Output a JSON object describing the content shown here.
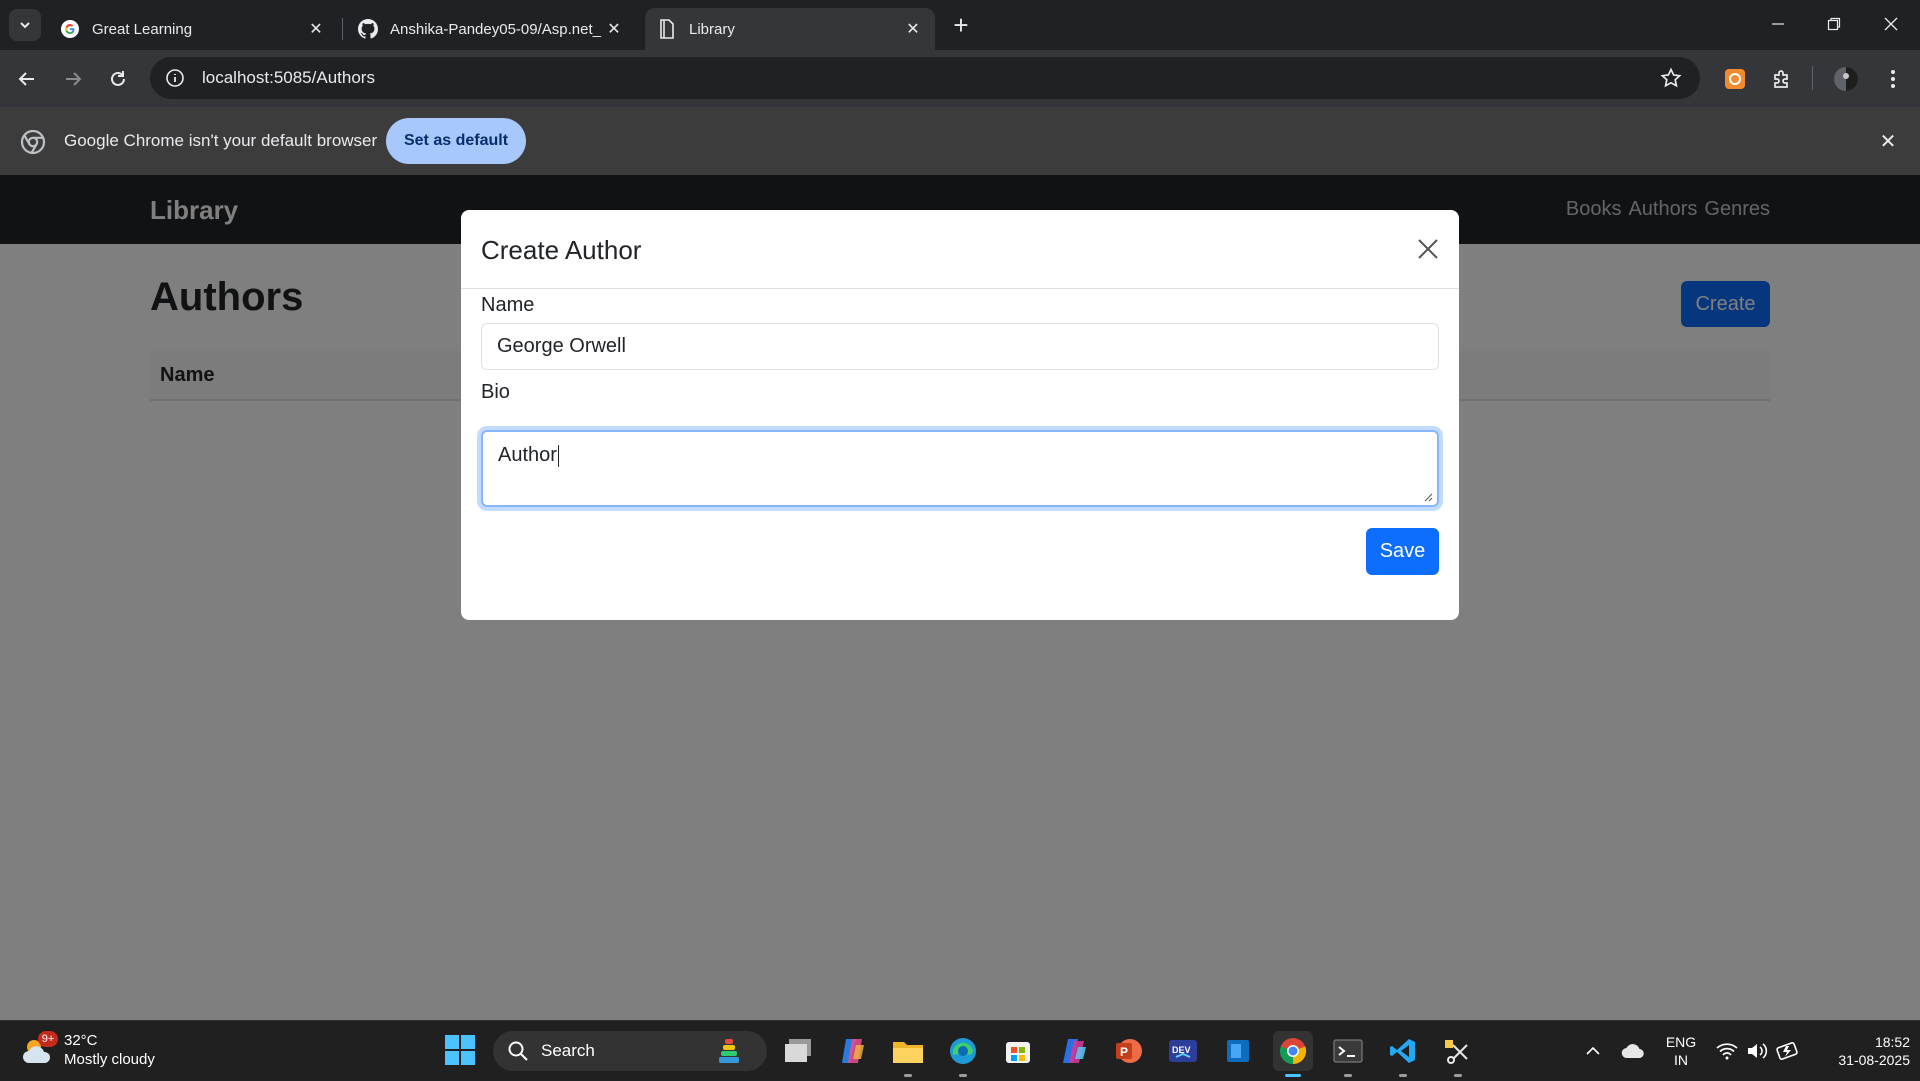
{
  "browser": {
    "tabs": [
      {
        "title": "Great Learning",
        "icon": "google-icon",
        "active": false
      },
      {
        "title": "Anshika-Pandey05-09/Asp.net_",
        "icon": "github-icon",
        "active": false
      },
      {
        "title": "Library",
        "icon": "document-icon",
        "active": true
      }
    ],
    "new_tab_label": "+",
    "url": "localhost:5085/Authors",
    "infobar": {
      "message": "Google Chrome isn't your default browser",
      "button_label": "Set as default"
    }
  },
  "app": {
    "brand": "Library",
    "nav_links": [
      "Books",
      "Authors",
      "Genres"
    ],
    "page_title": "Authors",
    "create_button": "Create",
    "table": {
      "headers": [
        "Name"
      ],
      "rows": []
    }
  },
  "modal": {
    "title": "Create Author",
    "fields": {
      "name": {
        "label": "Name",
        "value": "George Orwell"
      },
      "bio": {
        "label": "Bio",
        "value": "Author"
      }
    },
    "save_label": "Save"
  },
  "taskbar": {
    "weather": {
      "badge": "9+",
      "temp": "32°C",
      "condition": "Mostly cloudy"
    },
    "search_label": "Search",
    "apps": [
      "file-manager-icon",
      "copilot-icon",
      "file-explorer-icon",
      "edge-icon",
      "store-icon",
      "m365-icon",
      "powerpoint-icon",
      "devhome-icon",
      "blue-app-icon",
      "chrome-icon",
      "terminal-icon",
      "vscode-icon",
      "snipping-tool-icon"
    ],
    "active_app": "chrome-icon",
    "language": {
      "line1": "ENG",
      "line2": "IN"
    },
    "clock": {
      "time": "18:52",
      "date": "31-08-2025"
    }
  },
  "colors": {
    "primary": "#0d6efd",
    "navbar": "#212529",
    "chrome_dark": "#202124",
    "set_default_button": "#a8c7fa"
  }
}
